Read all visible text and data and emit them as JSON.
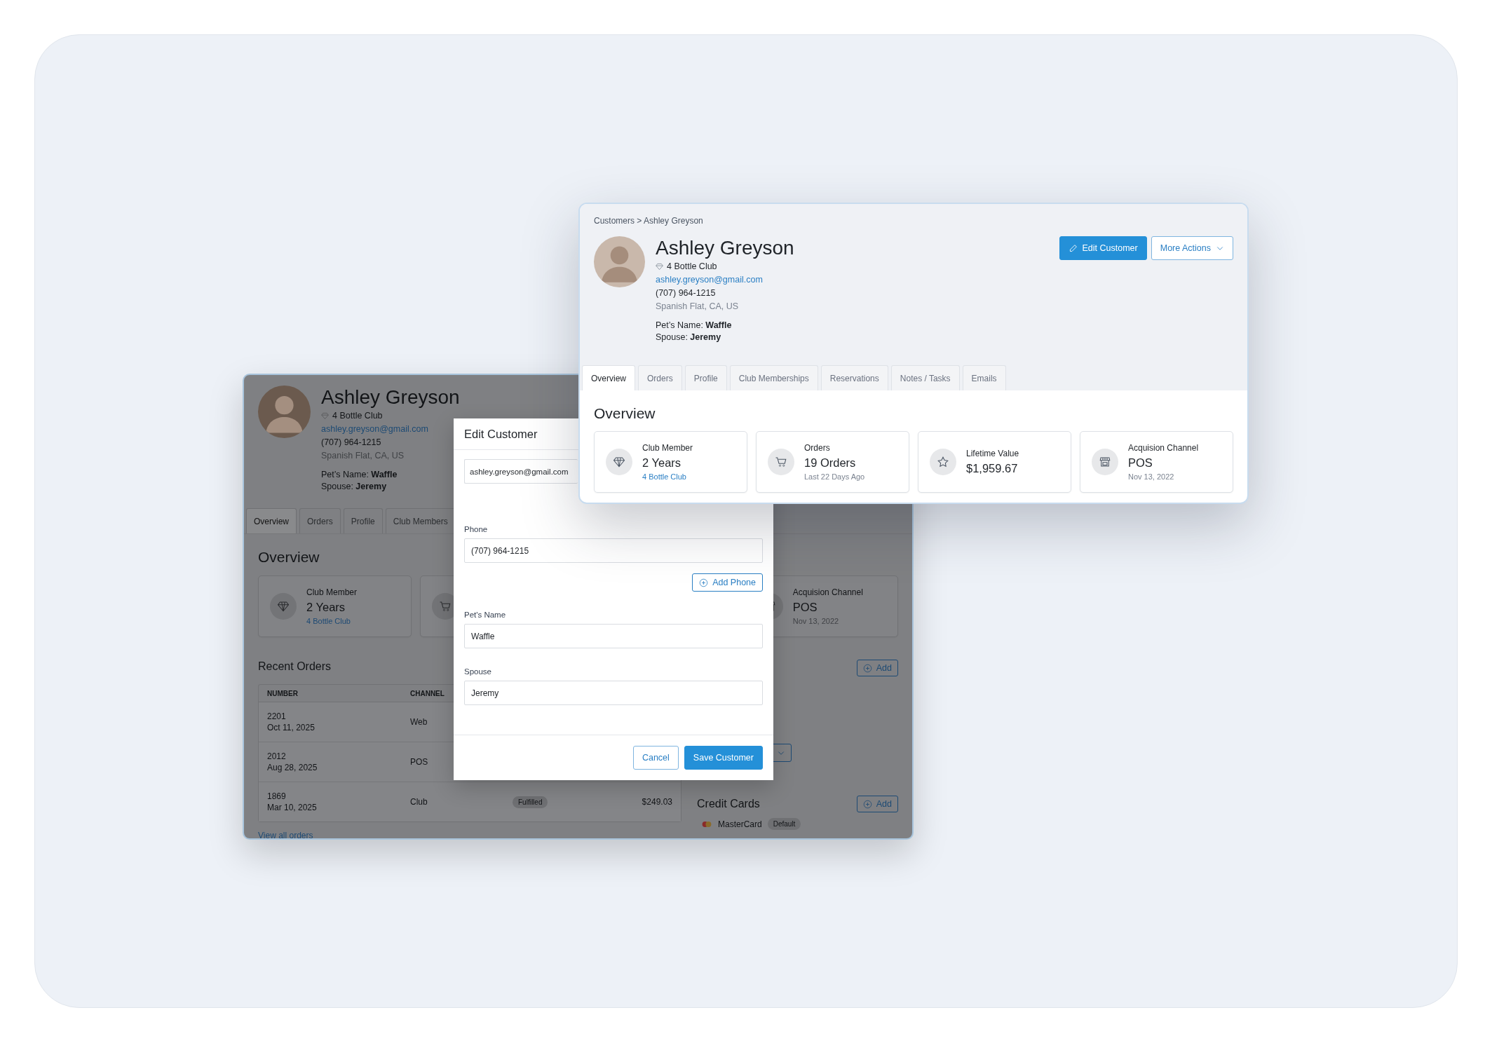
{
  "back_window": {
    "customer": {
      "name": "Ashley Greyson",
      "club": "4 Bottle Club",
      "email": "ashley.greyson@gmail.com",
      "phone": "(707) 964-1215",
      "location": "Spanish Flat, CA, US",
      "details": [
        "Pet’s Name: **Waffle**",
        "Spouse: **Jeremy**"
      ]
    },
    "tabs": [
      {
        "label": "Overview",
        "selected": true
      },
      {
        "label": "Orders",
        "selected": false
      },
      {
        "label": "Profile",
        "selected": false
      },
      {
        "label": "Club Members",
        "selected": false
      }
    ],
    "section_title": "Overview",
    "stats": [
      {
        "kind": "club",
        "label": "Club Member",
        "value": "2 Years",
        "sub": "4 Bottle Club",
        "sub_is_link": true
      },
      {
        "kind": "orders"
      },
      {
        "kind": "acquisition",
        "label": "Acquision Channel",
        "value": "POS",
        "sub": "Nov 13, 2022",
        "sub_is_link": false
      }
    ],
    "recent_orders": {
      "title": "Recent Orders",
      "columns": [
        "NUMBER",
        "CHANNEL"
      ],
      "rows": [
        {
          "number": "2201",
          "date": "Oct 11, 2025",
          "channel": "Web"
        },
        {
          "number": "2012",
          "date": "Aug 28, 2025",
          "channel": "POS"
        },
        {
          "number": "1869",
          "date": "Mar 10, 2025",
          "channel": "Club",
          "status": "Fulfilled",
          "amount": "$249.03"
        }
      ],
      "link": "View all orders"
    },
    "addresses": {
      "add_button": "Add"
    },
    "credit_cards": {
      "title": "Credit Cards",
      "add_button": "Add",
      "cards": [
        {
          "brand": "MasterCard",
          "badge": "Default"
        }
      ]
    }
  },
  "edit_dialog": {
    "title": "Edit Customer",
    "fields": [
      {
        "kind": "email",
        "value": "ashley.greyson@gmail.com"
      },
      {
        "kind": "phone",
        "label": "Phone",
        "value": "(707) 964-1215",
        "add_button": "Add Phone"
      },
      {
        "kind": "text",
        "label": "Pet's Name",
        "value": "Waffle"
      },
      {
        "kind": "text",
        "label": "Spouse",
        "value": "Jeremy"
      }
    ],
    "buttons": [
      {
        "label": "Cancel",
        "kind": "secondary"
      },
      {
        "label": "Save Customer",
        "kind": "primary"
      }
    ]
  },
  "front_window": {
    "breadcrumb": "Customers > Ashley Greyson",
    "customer": {
      "name": "Ashley Greyson",
      "club": "4 Bottle Club",
      "email": "ashley.greyson@gmail.com",
      "phone": "(707) 964-1215",
      "location": "Spanish Flat, CA, US",
      "details": [
        "Pet’s Name: **Waffle**",
        "Spouse: **Jeremy**"
      ]
    },
    "actions": [
      {
        "label": "Edit Customer",
        "kind": "primary"
      },
      {
        "label": "More Actions",
        "kind": "dropdown"
      }
    ],
    "tabs": [
      {
        "label": "Overview",
        "selected": true
      },
      {
        "label": "Orders",
        "selected": false
      },
      {
        "label": "Profile",
        "selected": false
      },
      {
        "label": "Club Memberships",
        "selected": false
      },
      {
        "label": "Reservations",
        "selected": false
      },
      {
        "label": "Notes / Tasks",
        "selected": false
      },
      {
        "label": "Emails",
        "selected": false
      }
    ],
    "section_title": "Overview",
    "stats": [
      {
        "kind": "club",
        "label": "Club Member",
        "value": "2 Years",
        "sub": "4 Bottle Club",
        "sub_is_link": true
      },
      {
        "kind": "orders",
        "label": "Orders",
        "value": "19 Orders",
        "sub": "Last 22 Days Ago",
        "sub_is_link": false
      },
      {
        "kind": "lifetime",
        "label": "Lifetime Value",
        "value": "$1,959.67"
      },
      {
        "kind": "acquisition",
        "label": "Acquision Channel",
        "value": "POS",
        "sub": "Nov 13, 2022",
        "sub_is_link": false
      }
    ]
  }
}
